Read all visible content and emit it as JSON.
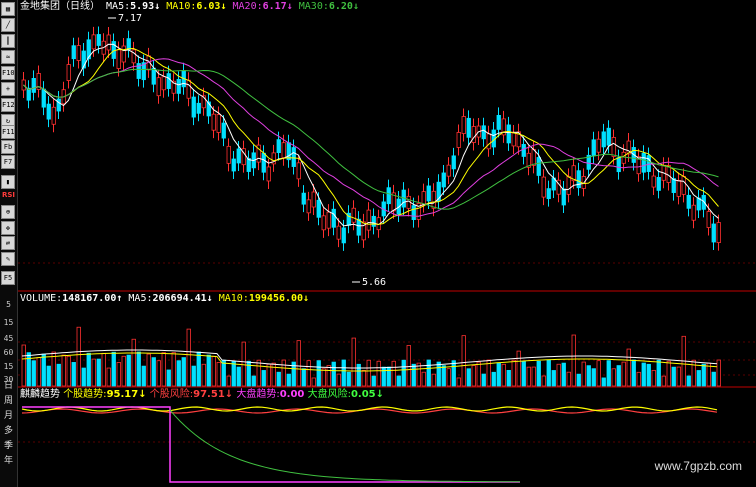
{
  "sidebar": {
    "icons": [
      "grid-icon",
      "line-chart-icon",
      "candle-icon",
      "indicator-icon",
      "f10-icon",
      "plus-icon",
      "f12-icon",
      "refresh-icon",
      "f11-icon",
      "fb-icon",
      "f7-icon",
      "risk-icon"
    ],
    "icon_labels": [
      "",
      "",
      "",
      "",
      "F10",
      "",
      "F12",
      "",
      "F11",
      "Fb",
      "F7",
      ""
    ],
    "bottom_icons": [
      "volume-icon",
      "rsi-icon",
      "lock-icon",
      "move-icon",
      "sync-icon",
      "pencil-icon"
    ],
    "f5_label": "F5",
    "scale_values": [
      "5",
      "15",
      "45",
      "30",
      "60",
      "15",
      "30"
    ],
    "period_labels": [
      "日",
      "周",
      "月",
      "多",
      "季",
      "年"
    ]
  },
  "price_panel": {
    "title": "金地集团（日线）",
    "ma5_label": "MA5:",
    "ma5_value": "5.93↓",
    "ma10_label": "MA10:",
    "ma10_value": "6.03↓",
    "ma20_label": "MA20:",
    "ma20_value": "6.17↓",
    "ma30_label": "MA30:",
    "ma30_value": "6.20↓",
    "high_label": "7.17",
    "low_label": "5.66"
  },
  "volume_panel": {
    "label": "VOLUME:",
    "value": "148167.00↑",
    "ma5_label": "MA5:",
    "ma5_value": "206694.41↓",
    "ma10_label": "MA10:",
    "ma10_value": "199456.00↓"
  },
  "indicator_panel": {
    "name": "麒麟趋势",
    "stock_trend_label": "个股趋势:",
    "stock_trend_value": "95.17↓",
    "stock_risk_label": "个股风险:",
    "stock_risk_value": "97.51↓",
    "market_trend_label": "大盘趋势:",
    "market_trend_value": "0.00",
    "market_risk_label": "大盘风险:",
    "market_risk_value": "0.05↓"
  },
  "watermark": "www.7gpzb.com",
  "colors": {
    "up": "#ff3030",
    "down": "#00e0ff",
    "ma5": "#ffffff",
    "ma10": "#ffff00",
    "ma20": "#e040e0",
    "ma30": "#40c040",
    "red_line": "#c00000"
  }
}
